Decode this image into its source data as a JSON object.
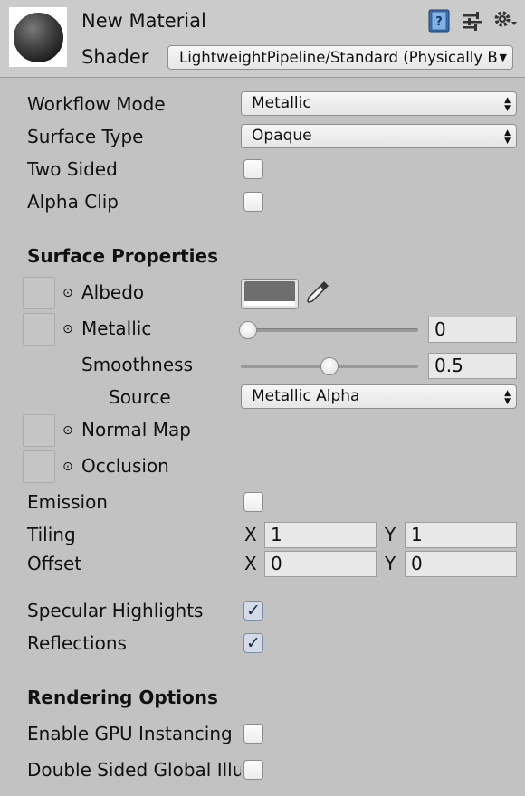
{
  "header": {
    "title": "New Material",
    "shader_label": "Shader",
    "shader_value": "LightweightPipeline/Standard (Physically Based)",
    "icons": [
      "book-icon",
      "sliders-icon",
      "gear-icon"
    ]
  },
  "settings": {
    "workflow_mode": {
      "label": "Workflow Mode",
      "value": "Metallic"
    },
    "surface_type": {
      "label": "Surface Type",
      "value": "Opaque"
    },
    "two_sided": {
      "label": "Two Sided",
      "checked": false
    },
    "alpha_clip": {
      "label": "Alpha Clip",
      "checked": false
    }
  },
  "surface": {
    "heading": "Surface Properties",
    "albedo": {
      "label": "Albedo",
      "color": "#6e6e6e"
    },
    "metallic": {
      "label": "Metallic",
      "value": "0",
      "level": 0
    },
    "smoothness": {
      "label": "Smoothness",
      "value": "0.5",
      "level": 0.5
    },
    "source": {
      "label": "Source",
      "value": "Metallic Alpha"
    },
    "normal_map": {
      "label": "Normal Map"
    },
    "occlusion": {
      "label": "Occlusion"
    },
    "emission": {
      "label": "Emission",
      "checked": false
    },
    "tiling": {
      "label": "Tiling",
      "x_label": "X",
      "x": "1",
      "y_label": "Y",
      "y": "1"
    },
    "offset": {
      "label": "Offset",
      "x_label": "X",
      "x": "0",
      "y_label": "Y",
      "y": "0"
    },
    "specular": {
      "label": "Specular Highlights",
      "checked": true
    },
    "reflections": {
      "label": "Reflections",
      "checked": true
    }
  },
  "rendering": {
    "heading": "Rendering Options",
    "gpu_instancing": {
      "label": "Enable GPU Instancing",
      "checked": false
    },
    "double_sided_gi": {
      "label": "Double Sided Global Illumination",
      "checked": false
    }
  }
}
